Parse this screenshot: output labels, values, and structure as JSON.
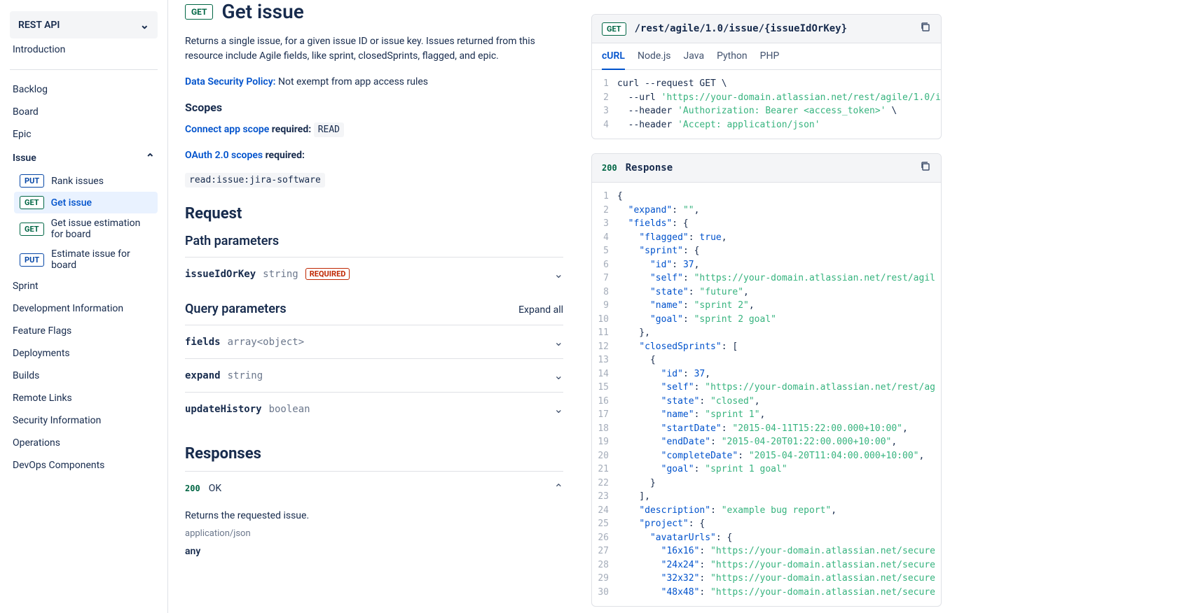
{
  "sidebar": {
    "select_label": "REST API",
    "intro": "Introduction",
    "items": [
      {
        "label": "Backlog"
      },
      {
        "label": "Board"
      },
      {
        "label": "Epic"
      },
      {
        "label": "Issue",
        "expanded": true
      },
      {
        "label": "Sprint"
      },
      {
        "label": "Development Information"
      },
      {
        "label": "Feature Flags"
      },
      {
        "label": "Deployments"
      },
      {
        "label": "Builds"
      },
      {
        "label": "Remote Links"
      },
      {
        "label": "Security Information"
      },
      {
        "label": "Operations"
      },
      {
        "label": "DevOps Components"
      }
    ],
    "issue_children": [
      {
        "method": "PUT",
        "label": "Rank issues"
      },
      {
        "method": "GET",
        "label": "Get issue",
        "active": true
      },
      {
        "method": "GET",
        "label": "Get issue estimation for board"
      },
      {
        "method": "PUT",
        "label": "Estimate issue for board"
      }
    ]
  },
  "page": {
    "method": "GET",
    "title": "Get issue",
    "description": "Returns a single issue, for a given issue ID or issue key. Issues returned from this resource include Agile fields, like sprint, closedSprints, flagged, and epic.",
    "dsp_label": "Data Security Policy:",
    "dsp_text": "Not exempt from app access rules",
    "scopes_heading": "Scopes",
    "connect_label": "Connect app scope",
    "required_text": "required",
    "connect_scope": "READ",
    "oauth_label": "OAuth 2.0 scopes",
    "oauth_scope": "read:issue:jira-software",
    "request_heading": "Request",
    "path_params_heading": "Path parameters",
    "query_params_heading": "Query parameters",
    "expand_all": "Expand all",
    "responses_heading": "Responses",
    "path_params": [
      {
        "name": "issueIdOrKey",
        "type": "string",
        "required": true
      }
    ],
    "query_params": [
      {
        "name": "fields",
        "type": "array<object>"
      },
      {
        "name": "expand",
        "type": "string"
      },
      {
        "name": "updateHistory",
        "type": "boolean"
      }
    ],
    "responses": [
      {
        "code": "200",
        "label": "OK",
        "desc": "Returns the requested issue.",
        "content_type": "application/json",
        "schema": "any"
      }
    ]
  },
  "code_example": {
    "method": "GET",
    "path": "/rest/agile/1.0/issue/{issueIdOrKey}",
    "tabs": [
      "cURL",
      "Node.js",
      "Java",
      "Python",
      "PHP"
    ],
    "active_tab": "cURL",
    "lines": [
      [
        {
          "t": "plain",
          "v": "curl --request GET \\"
        }
      ],
      [
        {
          "t": "plain",
          "v": "  --url "
        },
        {
          "t": "str",
          "v": "'https://your-domain.atlassian.net/rest/agile/1.0/i"
        }
      ],
      [
        {
          "t": "plain",
          "v": "  --header "
        },
        {
          "t": "str",
          "v": "'Authorization: Bearer <access_token>'"
        },
        {
          "t": "plain",
          "v": " \\"
        }
      ],
      [
        {
          "t": "plain",
          "v": "  --header "
        },
        {
          "t": "str",
          "v": "'Accept: application/json'"
        }
      ]
    ]
  },
  "response_example": {
    "status": "200",
    "label": "Response",
    "lines": [
      [
        {
          "t": "plain",
          "v": "{"
        }
      ],
      [
        {
          "t": "plain",
          "v": "  "
        },
        {
          "t": "key",
          "v": "\"expand\""
        },
        {
          "t": "plain",
          "v": ": "
        },
        {
          "t": "str",
          "v": "\"\""
        },
        {
          "t": "plain",
          "v": ","
        }
      ],
      [
        {
          "t": "plain",
          "v": "  "
        },
        {
          "t": "key",
          "v": "\"fields\""
        },
        {
          "t": "plain",
          "v": ": {"
        }
      ],
      [
        {
          "t": "plain",
          "v": "    "
        },
        {
          "t": "key",
          "v": "\"flagged\""
        },
        {
          "t": "plain",
          "v": ": "
        },
        {
          "t": "bool",
          "v": "true"
        },
        {
          "t": "plain",
          "v": ","
        }
      ],
      [
        {
          "t": "plain",
          "v": "    "
        },
        {
          "t": "key",
          "v": "\"sprint\""
        },
        {
          "t": "plain",
          "v": ": {"
        }
      ],
      [
        {
          "t": "plain",
          "v": "      "
        },
        {
          "t": "key",
          "v": "\"id\""
        },
        {
          "t": "plain",
          "v": ": "
        },
        {
          "t": "num",
          "v": "37"
        },
        {
          "t": "plain",
          "v": ","
        }
      ],
      [
        {
          "t": "plain",
          "v": "      "
        },
        {
          "t": "key",
          "v": "\"self\""
        },
        {
          "t": "plain",
          "v": ": "
        },
        {
          "t": "str",
          "v": "\"https://your-domain.atlassian.net/rest/agil"
        }
      ],
      [
        {
          "t": "plain",
          "v": "      "
        },
        {
          "t": "key",
          "v": "\"state\""
        },
        {
          "t": "plain",
          "v": ": "
        },
        {
          "t": "str",
          "v": "\"future\""
        },
        {
          "t": "plain",
          "v": ","
        }
      ],
      [
        {
          "t": "plain",
          "v": "      "
        },
        {
          "t": "key",
          "v": "\"name\""
        },
        {
          "t": "plain",
          "v": ": "
        },
        {
          "t": "str",
          "v": "\"sprint 2\""
        },
        {
          "t": "plain",
          "v": ","
        }
      ],
      [
        {
          "t": "plain",
          "v": "      "
        },
        {
          "t": "key",
          "v": "\"goal\""
        },
        {
          "t": "plain",
          "v": ": "
        },
        {
          "t": "str",
          "v": "\"sprint 2 goal\""
        }
      ],
      [
        {
          "t": "plain",
          "v": "    },"
        }
      ],
      [
        {
          "t": "plain",
          "v": "    "
        },
        {
          "t": "key",
          "v": "\"closedSprints\""
        },
        {
          "t": "plain",
          "v": ": ["
        }
      ],
      [
        {
          "t": "plain",
          "v": "      {"
        }
      ],
      [
        {
          "t": "plain",
          "v": "        "
        },
        {
          "t": "key",
          "v": "\"id\""
        },
        {
          "t": "plain",
          "v": ": "
        },
        {
          "t": "num",
          "v": "37"
        },
        {
          "t": "plain",
          "v": ","
        }
      ],
      [
        {
          "t": "plain",
          "v": "        "
        },
        {
          "t": "key",
          "v": "\"self\""
        },
        {
          "t": "plain",
          "v": ": "
        },
        {
          "t": "str",
          "v": "\"https://your-domain.atlassian.net/rest/ag"
        }
      ],
      [
        {
          "t": "plain",
          "v": "        "
        },
        {
          "t": "key",
          "v": "\"state\""
        },
        {
          "t": "plain",
          "v": ": "
        },
        {
          "t": "str",
          "v": "\"closed\""
        },
        {
          "t": "plain",
          "v": ","
        }
      ],
      [
        {
          "t": "plain",
          "v": "        "
        },
        {
          "t": "key",
          "v": "\"name\""
        },
        {
          "t": "plain",
          "v": ": "
        },
        {
          "t": "str",
          "v": "\"sprint 1\""
        },
        {
          "t": "plain",
          "v": ","
        }
      ],
      [
        {
          "t": "plain",
          "v": "        "
        },
        {
          "t": "key",
          "v": "\"startDate\""
        },
        {
          "t": "plain",
          "v": ": "
        },
        {
          "t": "str",
          "v": "\"2015-04-11T15:22:00.000+10:00\""
        },
        {
          "t": "plain",
          "v": ","
        }
      ],
      [
        {
          "t": "plain",
          "v": "        "
        },
        {
          "t": "key",
          "v": "\"endDate\""
        },
        {
          "t": "plain",
          "v": ": "
        },
        {
          "t": "str",
          "v": "\"2015-04-20T01:22:00.000+10:00\""
        },
        {
          "t": "plain",
          "v": ","
        }
      ],
      [
        {
          "t": "plain",
          "v": "        "
        },
        {
          "t": "key",
          "v": "\"completeDate\""
        },
        {
          "t": "plain",
          "v": ": "
        },
        {
          "t": "str",
          "v": "\"2015-04-20T11:04:00.000+10:00\""
        },
        {
          "t": "plain",
          "v": ","
        }
      ],
      [
        {
          "t": "plain",
          "v": "        "
        },
        {
          "t": "key",
          "v": "\"goal\""
        },
        {
          "t": "plain",
          "v": ": "
        },
        {
          "t": "str",
          "v": "\"sprint 1 goal\""
        }
      ],
      [
        {
          "t": "plain",
          "v": "      }"
        }
      ],
      [
        {
          "t": "plain",
          "v": "    ],"
        }
      ],
      [
        {
          "t": "plain",
          "v": "    "
        },
        {
          "t": "key",
          "v": "\"description\""
        },
        {
          "t": "plain",
          "v": ": "
        },
        {
          "t": "str",
          "v": "\"example bug report\""
        },
        {
          "t": "plain",
          "v": ","
        }
      ],
      [
        {
          "t": "plain",
          "v": "    "
        },
        {
          "t": "key",
          "v": "\"project\""
        },
        {
          "t": "plain",
          "v": ": {"
        }
      ],
      [
        {
          "t": "plain",
          "v": "      "
        },
        {
          "t": "key",
          "v": "\"avatarUrls\""
        },
        {
          "t": "plain",
          "v": ": {"
        }
      ],
      [
        {
          "t": "plain",
          "v": "        "
        },
        {
          "t": "key",
          "v": "\"16x16\""
        },
        {
          "t": "plain",
          "v": ": "
        },
        {
          "t": "str",
          "v": "\"https://your-domain.atlassian.net/secure"
        }
      ],
      [
        {
          "t": "plain",
          "v": "        "
        },
        {
          "t": "key",
          "v": "\"24x24\""
        },
        {
          "t": "plain",
          "v": ": "
        },
        {
          "t": "str",
          "v": "\"https://your-domain.atlassian.net/secure"
        }
      ],
      [
        {
          "t": "plain",
          "v": "        "
        },
        {
          "t": "key",
          "v": "\"32x32\""
        },
        {
          "t": "plain",
          "v": ": "
        },
        {
          "t": "str",
          "v": "\"https://your-domain.atlassian.net/secure"
        }
      ],
      [
        {
          "t": "plain",
          "v": "        "
        },
        {
          "t": "key",
          "v": "\"48x48\""
        },
        {
          "t": "plain",
          "v": ": "
        },
        {
          "t": "str",
          "v": "\"https://your-domain.atlassian.net/secure"
        }
      ]
    ]
  },
  "required_badge": "REQUIRED"
}
